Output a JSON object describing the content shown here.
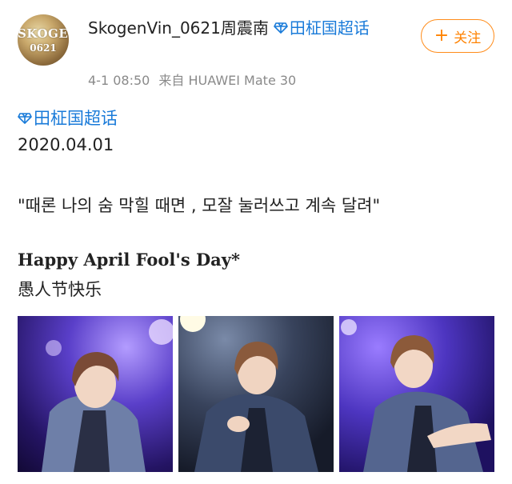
{
  "post": {
    "username": "SkogenVin_0621周震南",
    "username_topic": "田柾国超话",
    "time": "4-1 08:50",
    "source": "来自 HUAWEI Mate 30",
    "follow_label": "关注",
    "topic": "田柾国超话",
    "date_line": "2020.04.01",
    "korean_line": "\"때론 나의 숨 막힐 때면 , 모잘 눌러쓰고 계속 달려\"",
    "greeting_en": "Happy April Fool's Day*",
    "greeting_zh": "愚人节快乐"
  },
  "avatar": {
    "line1": "SKOGEN",
    "line2": "0621"
  },
  "colors": {
    "link": "#1a7bd9",
    "follow": "#ff8200",
    "meta": "#8a8a8a"
  },
  "icons": {
    "topic": "diamond-icon",
    "follow": "plus-icon"
  }
}
